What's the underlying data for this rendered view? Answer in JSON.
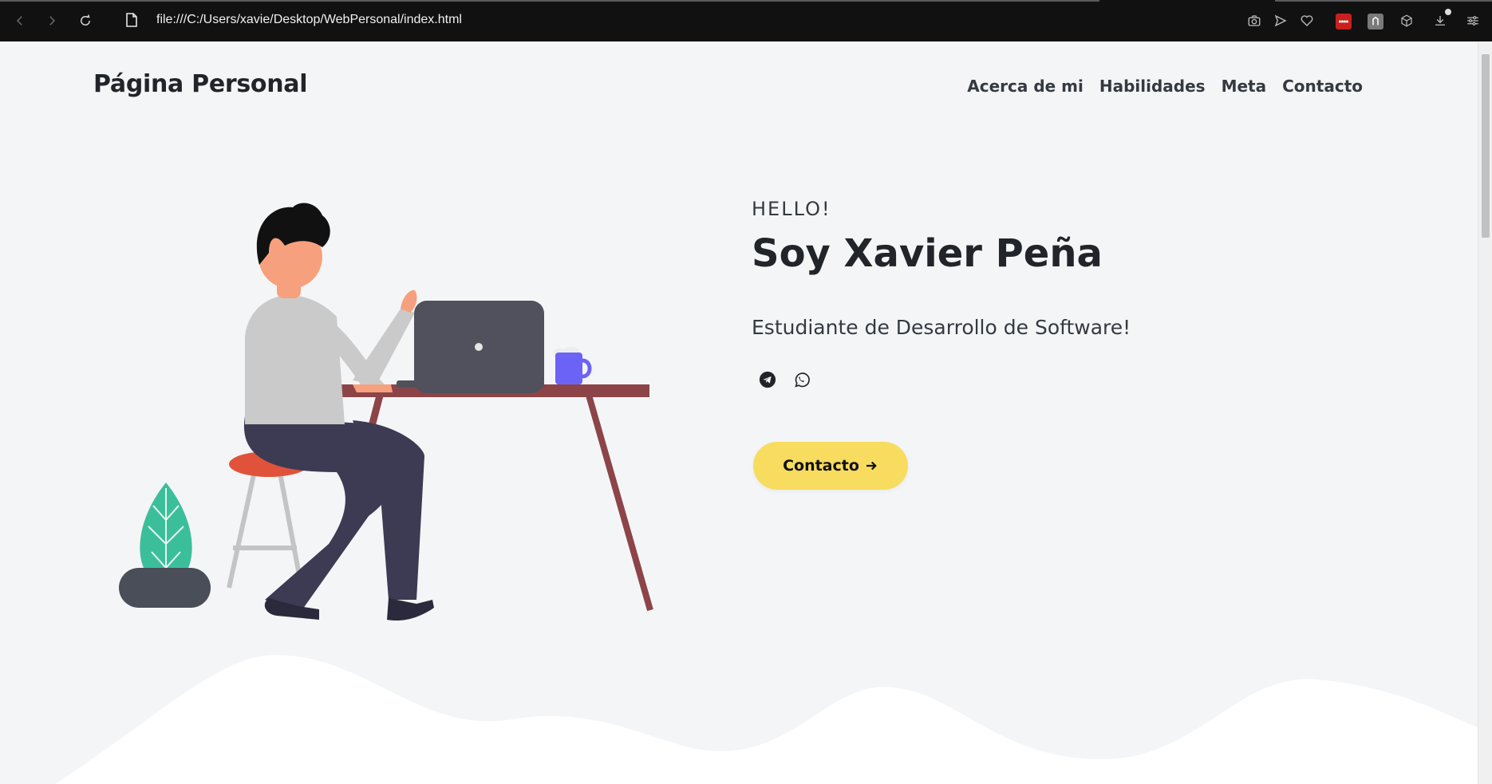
{
  "browser": {
    "url": "file:///C:/Users/xavie/Desktop/WebPersonal/index.html"
  },
  "header": {
    "brand": "Página Personal",
    "menu": [
      "Acerca de mi",
      "Habilidades",
      "Meta",
      "Contacto"
    ]
  },
  "hero": {
    "greeting": "HELLO!",
    "name": "Soy Xavier Peña",
    "subtitle": "Estudiante de Desarrollo de Software!",
    "cta_label": "Contacto",
    "social_icons": [
      "telegram-icon",
      "whatsapp-icon"
    ]
  },
  "colors": {
    "accent": "#f7dc5f",
    "background": "#f4f5f7",
    "text": "#212529"
  }
}
